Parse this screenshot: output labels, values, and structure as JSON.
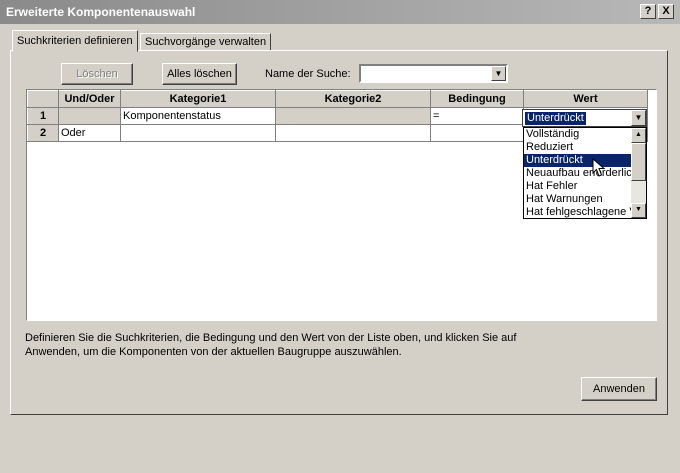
{
  "window": {
    "title": "Erweiterte Komponentenauswahl",
    "help_btn": "?",
    "close_btn": "X"
  },
  "tabs": [
    {
      "label": "Suchkriterien definieren"
    },
    {
      "label": "Suchvorgänge verwalten"
    }
  ],
  "toolbar": {
    "delete_label": "Löschen",
    "delete_all_label": "Alles löschen",
    "search_name_label": "Name der Suche:",
    "search_name_value": ""
  },
  "grid": {
    "columns": [
      "Und/Oder",
      "Kategorie1",
      "Kategorie2",
      "Bedingung",
      "Wert"
    ],
    "rows": [
      {
        "num": "1",
        "andor": "",
        "cat1": "Komponentenstatus",
        "cat2": "",
        "cond": "=",
        "value": "Unterdrückt"
      },
      {
        "num": "2",
        "andor": "Oder",
        "cat1": "",
        "cat2": "",
        "cond": "",
        "value": ""
      }
    ]
  },
  "value_dropdown": {
    "options": [
      "Vollständig",
      "Reduziert",
      "Unterdrückt",
      "Neuaufbau erforderlich",
      "Hat Fehler",
      "Hat Warnungen",
      "Hat fehlgeschlagene Verknüpfungen"
    ],
    "selected": "Unterdrückt"
  },
  "help_text": "Definieren Sie die Suchkriterien, die Bedingung und den Wert von der Liste oben, und klicken Sie auf Anwenden, um die Komponenten von der aktuellen Baugruppe auszuwählen.",
  "apply_label": "Anwenden"
}
